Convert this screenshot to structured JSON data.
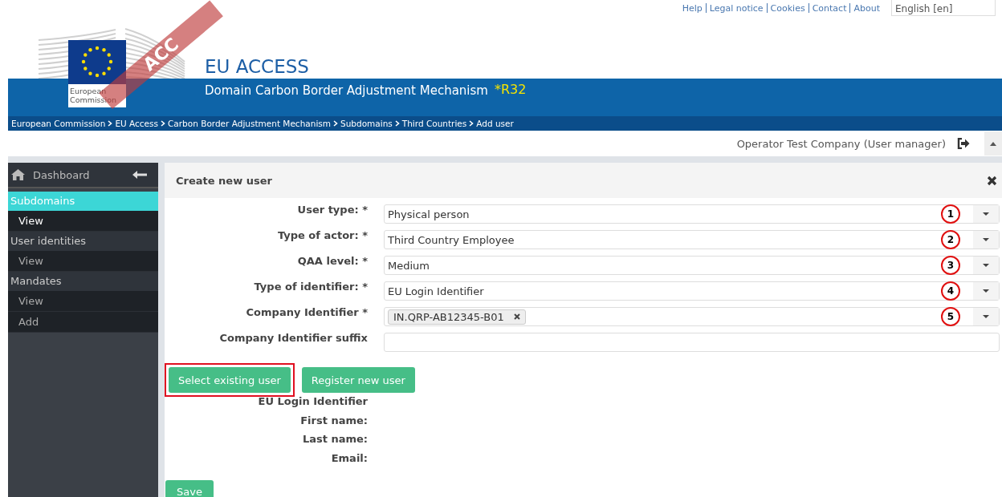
{
  "top_links": [
    "Help",
    "Legal notice",
    "Cookies",
    "Contact",
    "About"
  ],
  "language": {
    "value": "English [en]"
  },
  "logo": {
    "label": "European Commission"
  },
  "environment_stamp": "ACC",
  "site_title": "EU ACCESS",
  "domain": {
    "title": "Domain Carbon Border Adjustment Mechanism",
    "release": "*R32"
  },
  "breadcrumb": [
    "European Commission",
    "EU Access",
    "Carbon Border Adjustment Mechanism",
    "Subdomains",
    "Third Countries",
    "Add user"
  ],
  "user_bar": {
    "user": "Operator Test Company (User manager)"
  },
  "sidebar": {
    "dashboard": "Dashboard",
    "sections": [
      {
        "label": "Subdomains",
        "selected": true,
        "children": [
          {
            "label": "View",
            "selected": true
          }
        ]
      },
      {
        "label": "User identities",
        "selected": false,
        "children": [
          {
            "label": "View",
            "selected": false
          }
        ]
      },
      {
        "label": "Mandates",
        "selected": false,
        "children": [
          {
            "label": "View",
            "selected": false
          },
          {
            "label": "Add",
            "selected": false
          }
        ]
      }
    ]
  },
  "panel": {
    "title": "Create new user",
    "fields": [
      {
        "kind": "select",
        "label": "User type: *",
        "value": "Physical person",
        "marker": "1"
      },
      {
        "kind": "select",
        "label": "Type of actor: *",
        "value": "Third Country Employee",
        "marker": "2"
      },
      {
        "kind": "select",
        "label": "QAA level: *",
        "value": "Medium",
        "marker": "3"
      },
      {
        "kind": "select",
        "label": "Type of identifier: *",
        "value": "EU Login Identifier",
        "marker": "4"
      },
      {
        "kind": "tags",
        "label": "Company Identifier *",
        "tags": [
          "IN.QRP-AB12345-B01"
        ],
        "marker": "5"
      },
      {
        "kind": "text",
        "label": "Company Identifier suffix"
      }
    ],
    "buttons": [
      {
        "label": "Select existing user",
        "highlighted": true
      },
      {
        "label": "Register new user",
        "highlighted": false
      }
    ],
    "info": [
      "EU Login Identifier",
      "First name:",
      "Last name:",
      "Email:"
    ],
    "save": "Save"
  }
}
